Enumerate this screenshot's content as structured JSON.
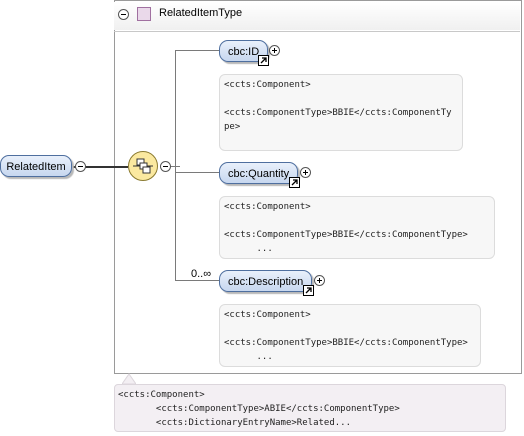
{
  "root_element": {
    "label": "RelatedItem"
  },
  "complex_type": {
    "label": "RelatedItemType"
  },
  "children": [
    {
      "label": "cbc:ID",
      "occurrence": "",
      "doc_lines": [
        "<ccts:Component>",
        "",
        "<ccts:ComponentType>BBIE</ccts:ComponentTy",
        "pe>"
      ]
    },
    {
      "label": "cbc:Quantity",
      "occurrence": "",
      "doc_lines": [
        "<ccts:Component>",
        "",
        "<ccts:ComponentType>BBIE</ccts:ComponentType>",
        "      ..."
      ]
    },
    {
      "label": "cbc:Description",
      "occurrence": "0..∞",
      "doc_lines": [
        "<ccts:Component>",
        "",
        "<ccts:ComponentType>BBIE</ccts:ComponentType>",
        "      ..."
      ]
    }
  ],
  "type_documentation": [
    "<ccts:Component>",
    "       <ccts:ComponentType>ABIE</ccts:ComponentType>",
    "       <ccts:DictionaryEntryName>Related..."
  ],
  "icons": {
    "sequence": "sequence-compositor-icon",
    "reference": "reference-arrow-icon",
    "type": "complex-type-icon"
  }
}
